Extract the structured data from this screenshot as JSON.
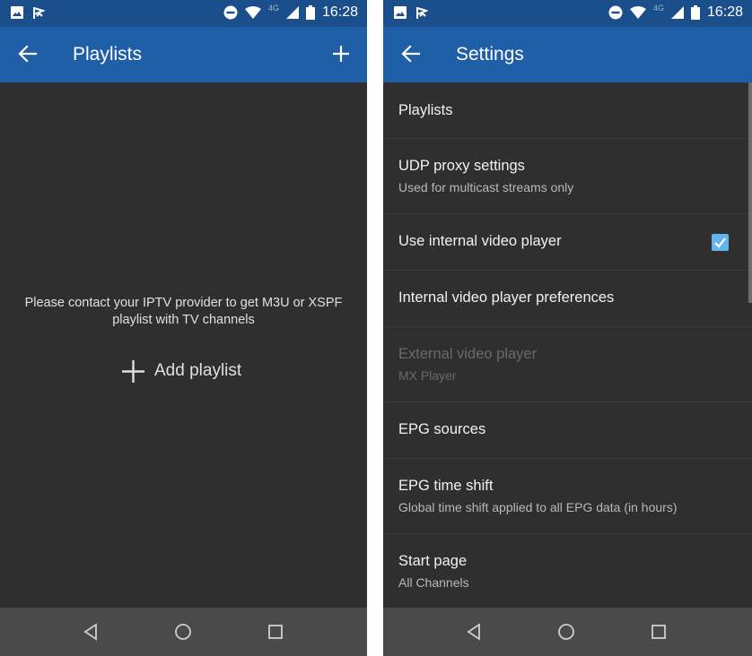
{
  "status_bar": {
    "time": "16:28",
    "network": "4G"
  },
  "left_screen": {
    "title": "Playlists",
    "empty_message_line1": "Please contact your IPTV provider to get M3U or XSPF",
    "empty_message_line2": "playlist with TV channels",
    "add_playlist_label": "Add playlist"
  },
  "right_screen": {
    "title": "Settings",
    "items": [
      {
        "title": "Playlists",
        "subtitle": ""
      },
      {
        "title": "UDP proxy settings",
        "subtitle": "Used for multicast streams only"
      },
      {
        "title": "Use internal video player",
        "subtitle": "",
        "checked": true
      },
      {
        "title": "Internal video player preferences",
        "subtitle": ""
      },
      {
        "title": "External video player",
        "subtitle": "MX Player",
        "disabled": true
      },
      {
        "title": "EPG sources",
        "subtitle": ""
      },
      {
        "title": "EPG time shift",
        "subtitle": "Global time shift applied to all EPG data (in hours)"
      },
      {
        "title": "Start page",
        "subtitle": "All Channels"
      }
    ]
  },
  "colors": {
    "status_bar": "#1b4f8c",
    "app_bar": "#1f5fa8",
    "background": "#2f2f2f",
    "nav_bar": "#4a4a4a",
    "checkbox_accent": "#63b4ea"
  }
}
